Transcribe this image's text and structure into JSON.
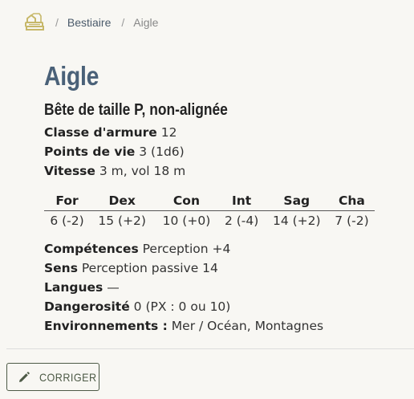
{
  "breadcrumb": {
    "home_icon": "dragon-book-icon",
    "separator": "/",
    "section": "Bestiaire",
    "current": "Aigle"
  },
  "creature": {
    "name": "Aigle",
    "subtitle": "Bête de taille P, non-alignée",
    "armor_class": {
      "label": "Classe d'armure",
      "value": "12"
    },
    "hit_points": {
      "label": "Points de vie",
      "value": "3 (1d6)"
    },
    "speed": {
      "label": "Vitesse",
      "value": "3 m, vol 18 m"
    },
    "abilities": [
      {
        "name": "For",
        "value": "6 (-2)"
      },
      {
        "name": "Dex",
        "value": "15 (+2)"
      },
      {
        "name": "Con",
        "value": "10 (+0)"
      },
      {
        "name": "Int",
        "value": "2 (-4)"
      },
      {
        "name": "Sag",
        "value": "14 (+2)"
      },
      {
        "name": "Cha",
        "value": "7 (-2)"
      }
    ],
    "skills": {
      "label": "Compétences",
      "value": "Perception +4"
    },
    "senses": {
      "label": "Sens",
      "value": "Perception passive 14"
    },
    "languages": {
      "label": "Langues",
      "value": "—"
    },
    "challenge": {
      "label": "Dangerosité",
      "value": "0 (PX : 0 ou 10)"
    },
    "environments": {
      "label": "Environnements :",
      "value": "Mer / Océan, Montagnes"
    }
  },
  "actions": {
    "fix_label": "CORRIGER",
    "fix_icon": "pencil-icon"
  },
  "colors": {
    "accent": "#c7b86a",
    "title": "#4a6178",
    "button": "#4d5a46"
  }
}
